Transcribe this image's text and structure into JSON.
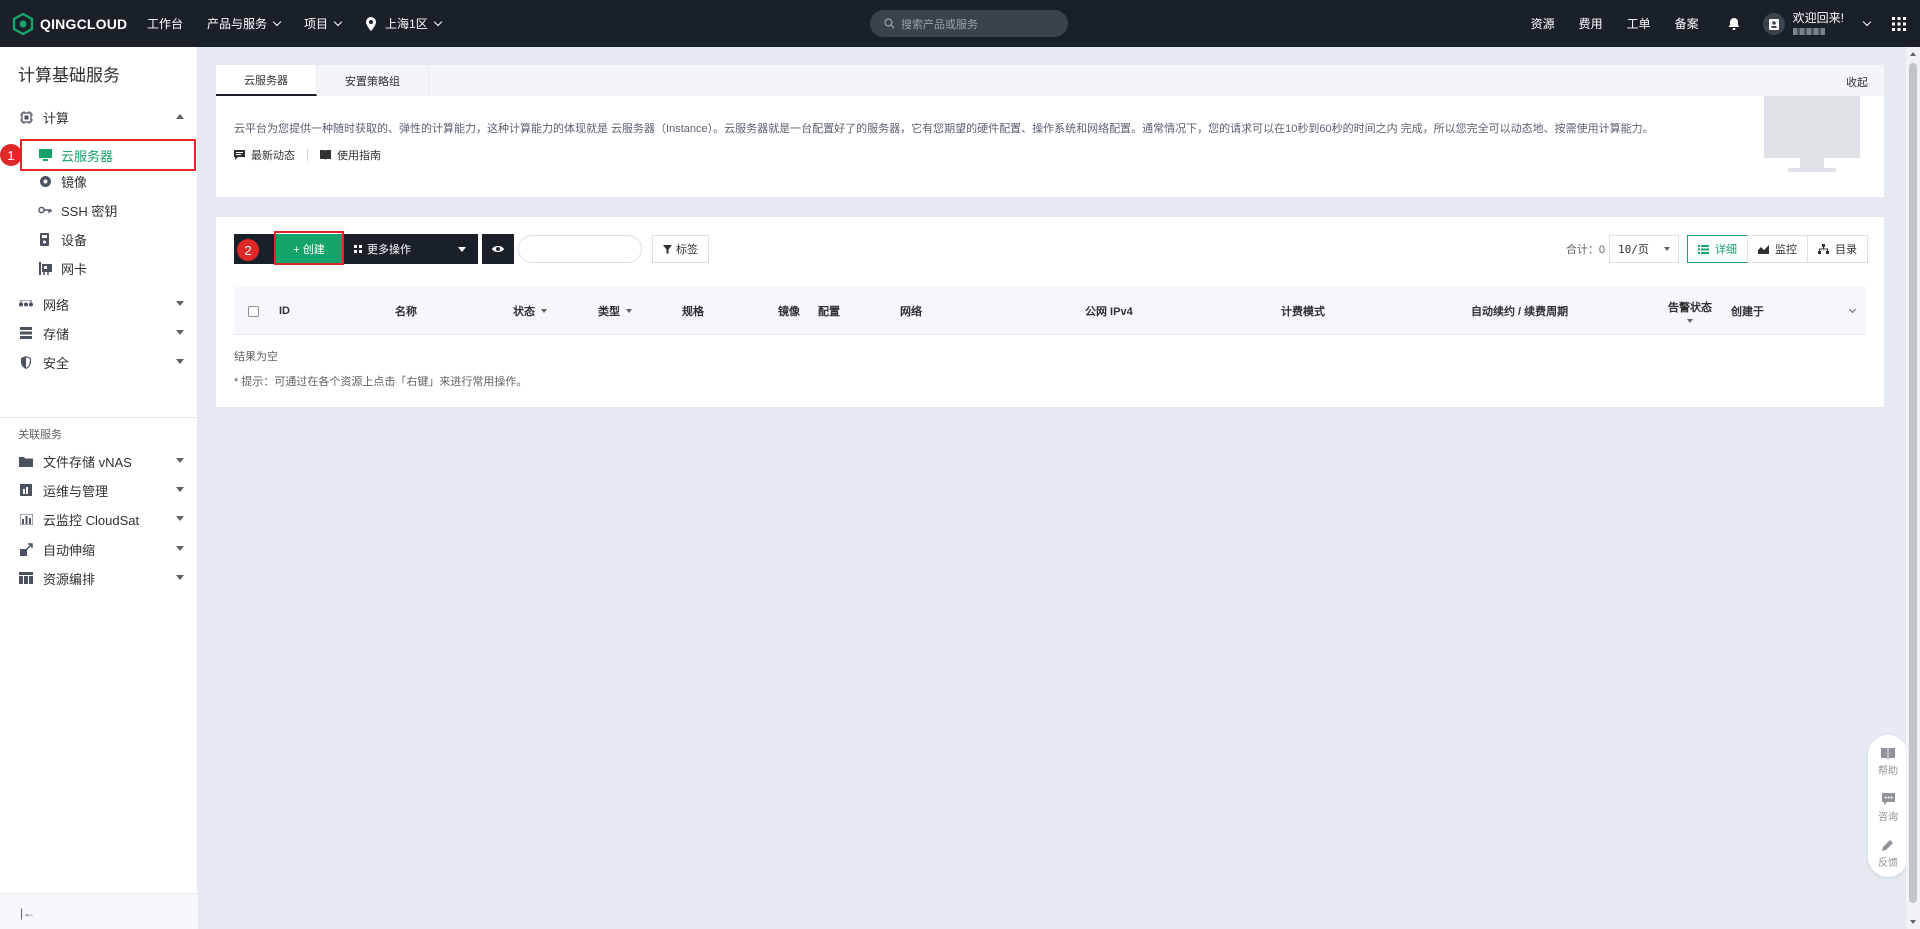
{
  "topbar": {
    "logo_text": "QINGCLOUD",
    "nav": [
      "工作台",
      "产品与服务",
      "项目"
    ],
    "region": "上海1区",
    "search_placeholder": "搜索产品或服务",
    "links": [
      "资源",
      "费用",
      "工单",
      "备案"
    ],
    "welcome": "欢迎回来!"
  },
  "sidebar": {
    "title": "计算基础服务",
    "compute": "计算",
    "compute_items": [
      "云服务器",
      "镜像",
      "SSH 密钥",
      "设备",
      "网卡"
    ],
    "groups": [
      "网络",
      "存储",
      "安全"
    ],
    "related_title": "关联服务",
    "related": [
      "文件存储 vNAS",
      "运维与管理",
      "云监控 CloudSat",
      "自动伸缩",
      "资源编排"
    ],
    "collapse_symbol": "|←"
  },
  "annotations": {
    "step1": "1",
    "step2": "2"
  },
  "tabs": {
    "items": [
      "云服务器",
      "安置策略组"
    ],
    "collapse": "收起",
    "intro": "云平台为您提供一种随时获取的、弹性的计算能力，这种计算能力的体现就是 云服务器（Instance）。云服务器就是一台配置好了的服务器，它有您期望的硬件配置、操作系统和网络配置。通常情况下，您的请求可以在10秒到60秒的时间之内 完成，所以您完全可以动态地、按需使用计算能力。",
    "link_news": "最新动态",
    "link_guide": "使用指南"
  },
  "toolbar": {
    "create": "+ 创建",
    "more": "更多操作",
    "tag": "标签",
    "total": "合计：0",
    "page_size": "10/页",
    "view_detail": "详细",
    "view_monitor": "监控",
    "view_catalog": "目录"
  },
  "table": {
    "columns": [
      "ID",
      "名称",
      "状态",
      "类型",
      "规格",
      "镜像",
      "配置",
      "网络",
      "公网 IPv4",
      "计费模式",
      "自动续约 / 续费周期",
      "告警状态",
      "创建于"
    ],
    "empty": "结果为空",
    "hint": "* 提示：可通过在各个资源上点击「右键」来进行常用操作。"
  },
  "float": {
    "help": "帮助",
    "consult": "咨询",
    "feedback": "反馈"
  },
  "colors": {
    "primary": "#14a369",
    "dark": "#1a2028",
    "highlight": "#e0282b"
  }
}
